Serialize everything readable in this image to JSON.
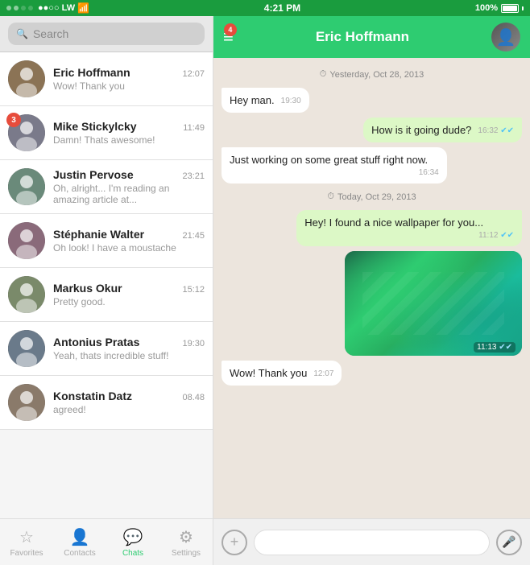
{
  "statusBar": {
    "signal": "●●○○ LW",
    "wifi": "WiFi",
    "time": "4:21 PM",
    "battery": "100%"
  },
  "leftPanel": {
    "search": {
      "placeholder": "Search"
    },
    "chats": [
      {
        "id": 1,
        "name": "Eric Hoffmann",
        "time": "12:07",
        "preview": "Wow! Thank you",
        "badge": null,
        "avatarColor": "av1"
      },
      {
        "id": 2,
        "name": "Mike Stickylcky",
        "time": "11:49",
        "preview": "Damn! Thats awesome!",
        "badge": 3,
        "avatarColor": "av2"
      },
      {
        "id": 3,
        "name": "Justin Pervose",
        "time": "23:21",
        "preview": "Oh, alright... I'm reading an amazing article at...",
        "badge": null,
        "avatarColor": "av3"
      },
      {
        "id": 4,
        "name": "Stéphanie Walter",
        "time": "21:45",
        "preview": "Oh look! I have a moustache",
        "badge": null,
        "avatarColor": "av4"
      },
      {
        "id": 5,
        "name": "Markus Okur",
        "time": "15:12",
        "preview": "Pretty good.",
        "badge": null,
        "avatarColor": "av5"
      },
      {
        "id": 6,
        "name": "Antonius Pratas",
        "time": "19:30",
        "preview": "Yeah, thats incredible stuff!",
        "badge": null,
        "avatarColor": "av6"
      },
      {
        "id": 7,
        "name": "Konstatin Datz",
        "time": "08.48",
        "preview": "agreed!",
        "badge": null,
        "avatarColor": "av7"
      }
    ],
    "tabs": [
      {
        "id": "favorites",
        "label": "Favorites",
        "icon": "☆",
        "active": false
      },
      {
        "id": "contacts",
        "label": "Contacts",
        "icon": "👤",
        "active": false
      },
      {
        "id": "chats",
        "label": "Chats",
        "icon": "💬",
        "active": true
      },
      {
        "id": "settings",
        "label": "Settings",
        "icon": "⚙",
        "active": false
      }
    ]
  },
  "rightPanel": {
    "header": {
      "title": "Eric Hoffmann",
      "menuBadge": 4
    },
    "messages": [
      {
        "type": "date-separator",
        "text": "Yesterday, Oct 28, 2013"
      },
      {
        "type": "incoming",
        "text": "Hey man.",
        "time": "19:30"
      },
      {
        "type": "outgoing",
        "text": "How is it going dude?",
        "time": "16:32",
        "ticks": "✔✔"
      },
      {
        "type": "incoming",
        "text": "Just working on some great stuff right now.",
        "time": "16:34"
      },
      {
        "type": "date-separator",
        "text": "Today, Oct 29, 2013"
      },
      {
        "type": "outgoing",
        "text": "Hey! I found a nice wallpaper for you...",
        "time": "11:12",
        "ticks": "✔✔"
      },
      {
        "type": "outgoing-image",
        "time": "11:13",
        "ticks": "✔✔"
      },
      {
        "type": "incoming",
        "text": "Wow! Thank you",
        "time": "12:07"
      }
    ],
    "inputBar": {
      "addIcon": "+",
      "micIcon": "🎤"
    }
  }
}
